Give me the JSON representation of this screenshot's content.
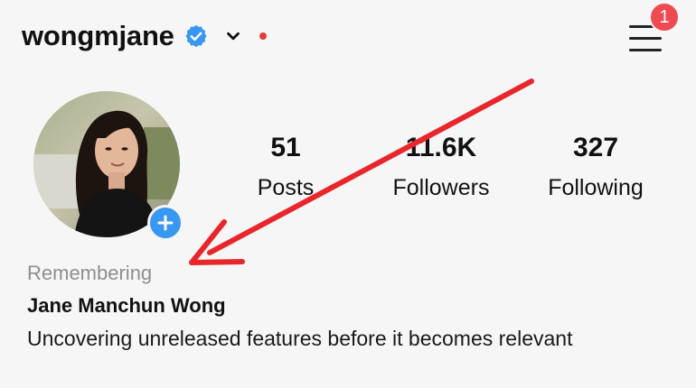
{
  "header": {
    "username": "wongmjane",
    "notification_count": "1"
  },
  "profile": {
    "memorial_label": "Remembering",
    "full_name": "Jane Manchun Wong",
    "bio": "Uncovering unreleased features before it becomes relevant"
  },
  "stats": [
    {
      "value": "51",
      "label": "Posts"
    },
    {
      "value": "11.6K",
      "label": "Followers"
    },
    {
      "value": "327",
      "label": "Following"
    }
  ],
  "icons": {
    "verified": "verified-badge-icon",
    "account_switch": "chevron-down-icon",
    "menu": "hamburger-menu-icon",
    "add_story": "plus-icon"
  },
  "colors": {
    "verified": "#3897f0",
    "badge": "#ee4a52",
    "annotation_arrow": "#e8262b",
    "muted_text": "#8f8f8f"
  }
}
